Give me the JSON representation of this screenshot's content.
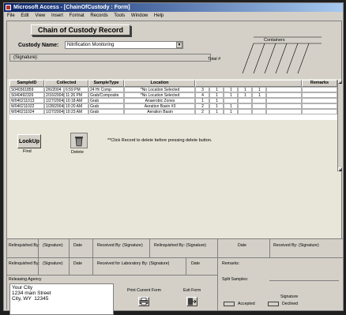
{
  "window": {
    "title": "Microsoft Access - [ChainOfCustody : Form]"
  },
  "menu": [
    "File",
    "Edit",
    "View",
    "Insert",
    "Format",
    "Records",
    "Tools",
    "Window",
    "Help"
  ],
  "header": {
    "form_title": "Chain of Custody Record",
    "custody_label": "Custody Name:",
    "custody_value": "Nitrification Monitoring",
    "signature_placeholder": "(Signature):",
    "total_label": "Total #",
    "containers_label": "Containers"
  },
  "grid": {
    "columns": [
      "SampleID",
      "Collected",
      "SampleType",
      "Location",
      "Remarks"
    ],
    "rows": [
      {
        "id": "S040361859",
        "date": "2/6/2004",
        "time": "6:59 PM",
        "type": "24 Hr Comp",
        "location": "*No Location Selected",
        "total": "3",
        "checks": [
          "1",
          "1",
          "1",
          "1",
          ""
        ]
      },
      {
        "id": "S040492326",
        "date": "2/16/2004",
        "time": "11:26 PM",
        "type": "Grab/Composite",
        "location": "*No Location Selected",
        "total": "4",
        "checks": [
          "1",
          "1",
          "1",
          "1",
          ""
        ]
      },
      {
        "id": "W040211013",
        "date": "1/27/2004",
        "time": "10:18 AM",
        "type": "Grab",
        "location": "Anaerobic Zones",
        "total": "1",
        "checks": [
          "1",
          "",
          "",
          "",
          ""
        ]
      },
      {
        "id": "W040211022",
        "date": "1/28/2004",
        "time": "10:20 AM",
        "type": "Grab",
        "location": "Aeration Basin #3",
        "total": "2",
        "checks": [
          "1",
          "1",
          "",
          "",
          ""
        ]
      },
      {
        "id": "W040211024",
        "date": "1/27/2004",
        "time": "10:23 AM",
        "type": "Grab",
        "location": "Aeration Basin",
        "total": "2",
        "checks": [
          "1",
          "1",
          "",
          "",
          ""
        ]
      }
    ]
  },
  "actions": {
    "lookup_label": "LookUp",
    "find_label": "Find",
    "delete_label": "Delete",
    "hint": "**Click Record to delete before pressing delete button."
  },
  "footer": {
    "relinquished_by": "Relinquished By:",
    "signature": "(Signature)",
    "date": "Date",
    "received_by": "Received By: (Signature)",
    "relinquished_by_sig": "Relinquished By: (Signature)",
    "received_lab": "Received for Laboratory By: (Signature)",
    "remarks": "Remarks:",
    "releasing_agency": "Releasing Agency",
    "address": "Your City\n1234 main Street\nCity, WY  12345",
    "split_samples": "Split Samples:",
    "print_form": "Print Current Form",
    "exit_form": "Exit Form",
    "signature_label": "Signature",
    "accepted": "Accepted",
    "declined": "Declined"
  }
}
